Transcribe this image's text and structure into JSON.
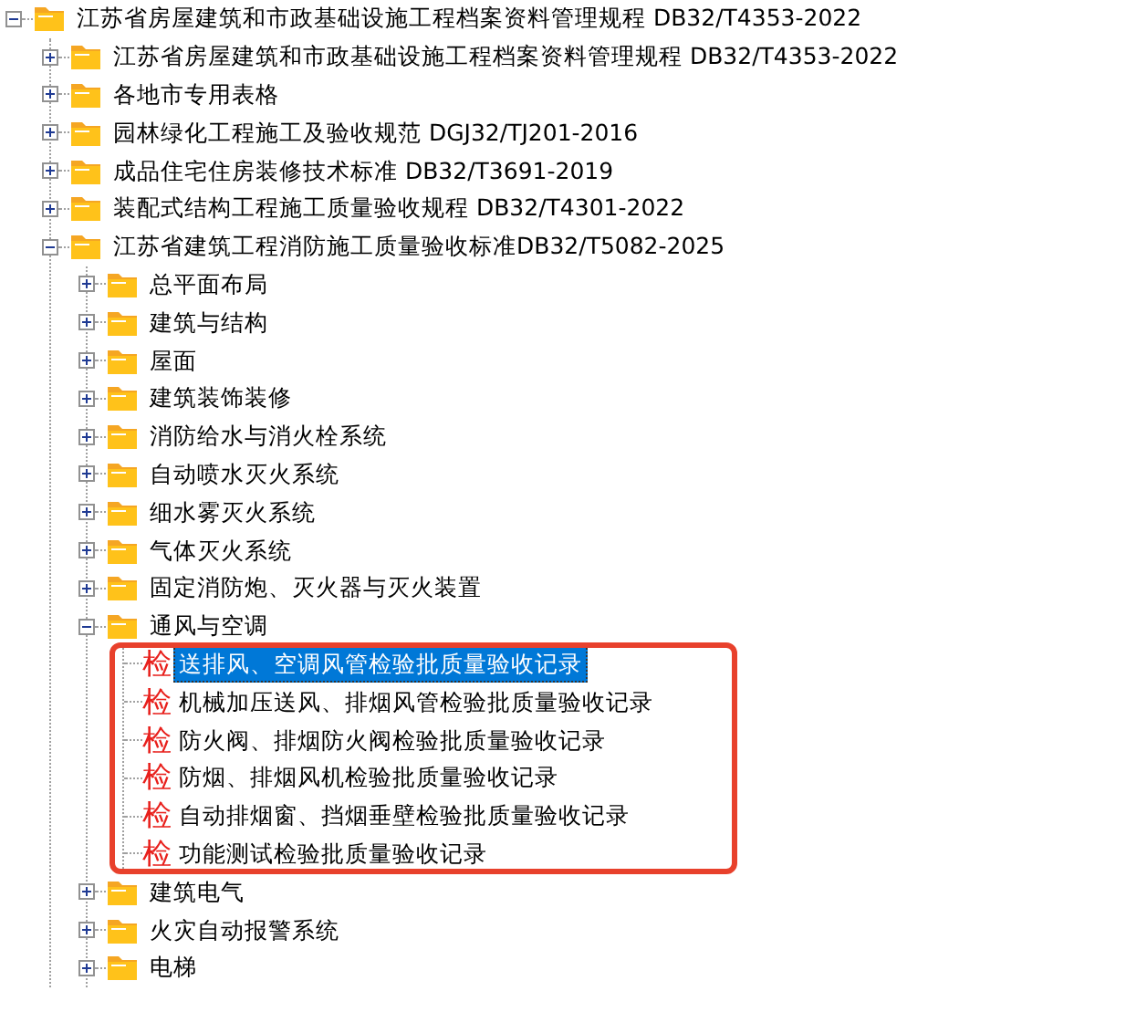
{
  "tree": [
    {
      "kind": "folder",
      "label": "江苏省房屋建筑和市政基础设施工程档案资料管理规程 DB32/T4353-2022",
      "expanded": true,
      "selected": false,
      "children": [
        {
          "kind": "folder",
          "label": "江苏省房屋建筑和市政基础设施工程档案资料管理规程 DB32/T4353-2022",
          "expanded": false,
          "selected": false
        },
        {
          "kind": "folder",
          "label": "各地市专用表格",
          "expanded": false,
          "selected": false
        },
        {
          "kind": "folder",
          "label": "园林绿化工程施工及验收规范 DGJ32/TJ201-2016",
          "expanded": false,
          "selected": false
        },
        {
          "kind": "folder",
          "label": "成品住宅住房装修技术标准 DB32/T3691-2019",
          "expanded": false,
          "selected": false
        },
        {
          "kind": "folder",
          "label": "装配式结构工程施工质量验收规程 DB32/T4301-2022",
          "expanded": false,
          "selected": false
        },
        {
          "kind": "folder",
          "label": "江苏省建筑工程消防施工质量验收标准DB32/T5082-2025",
          "expanded": true,
          "selected": false,
          "children": [
            {
              "kind": "folder",
              "label": "总平面布局",
              "expanded": false,
              "selected": false
            },
            {
              "kind": "folder",
              "label": "建筑与结构",
              "expanded": false,
              "selected": false
            },
            {
              "kind": "folder",
              "label": "屋面",
              "expanded": false,
              "selected": false
            },
            {
              "kind": "folder",
              "label": "建筑装饰装修",
              "expanded": false,
              "selected": false
            },
            {
              "kind": "folder",
              "label": "消防给水与消火栓系统",
              "expanded": false,
              "selected": false
            },
            {
              "kind": "folder",
              "label": "自动喷水灭火系统",
              "expanded": false,
              "selected": false
            },
            {
              "kind": "folder",
              "label": "细水雾灭火系统",
              "expanded": false,
              "selected": false
            },
            {
              "kind": "folder",
              "label": "气体灭火系统",
              "expanded": false,
              "selected": false
            },
            {
              "kind": "folder",
              "label": "固定消防炮、灭火器与灭火装置",
              "expanded": false,
              "selected": false
            },
            {
              "kind": "folder",
              "label": "通风与空调",
              "expanded": true,
              "selected": false,
              "children": [
                {
                  "kind": "record",
                  "icon": "检",
                  "label": "送排风、空调风管检验批质量验收记录",
                  "selected": true
                },
                {
                  "kind": "record",
                  "icon": "检",
                  "label": "机械加压送风、排烟风管检验批质量验收记录",
                  "selected": false
                },
                {
                  "kind": "record",
                  "icon": "检",
                  "label": "防火阀、排烟防火阀检验批质量验收记录",
                  "selected": false
                },
                {
                  "kind": "record",
                  "icon": "检",
                  "label": "防烟、排烟风机检验批质量验收记录",
                  "selected": false
                },
                {
                  "kind": "record",
                  "icon": "检",
                  "label": "自动排烟窗、挡烟垂壁检验批质量验收记录",
                  "selected": false
                },
                {
                  "kind": "record",
                  "icon": "检",
                  "label": "功能测试检验批质量验收记录",
                  "selected": false
                }
              ]
            },
            {
              "kind": "folder",
              "label": "建筑电气",
              "expanded": false,
              "selected": false
            },
            {
              "kind": "folder",
              "label": "火灾自动报警系统",
              "expanded": false,
              "selected": false
            },
            {
              "kind": "folder",
              "label": "电梯",
              "expanded": false,
              "selected": false
            }
          ]
        }
      ]
    }
  ],
  "highlight_frame": true
}
